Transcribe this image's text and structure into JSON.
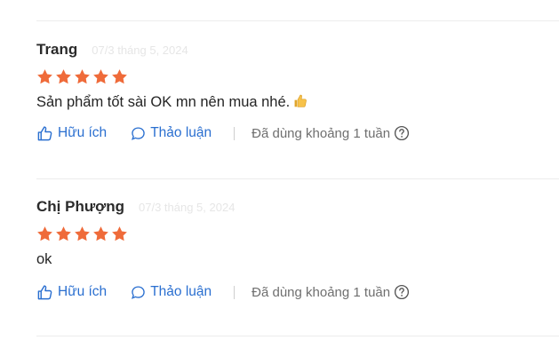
{
  "colors": {
    "star": "#ef6b3a",
    "link": "#2a6fd0",
    "muted": "#6f6f6f",
    "divider": "#ececec"
  },
  "reviews": [
    {
      "author": "Trang",
      "date": "07/3 tháng 5, 2024",
      "rating": 5,
      "content": "Sản phẩm tốt sài OK mn nên mua nhé.",
      "content_icon": "thumbs-up-emoji",
      "helpful_label": "Hữu ích",
      "discuss_label": "Thảo luận",
      "usage": "Đã dùng khoảng 1 tuần"
    },
    {
      "author": "Chị Phượng",
      "date": "07/3 tháng 5, 2024",
      "rating": 5,
      "content": "ok",
      "helpful_label": "Hữu ích",
      "discuss_label": "Thảo luận",
      "usage": "Đã dùng khoảng 1 tuần"
    }
  ]
}
